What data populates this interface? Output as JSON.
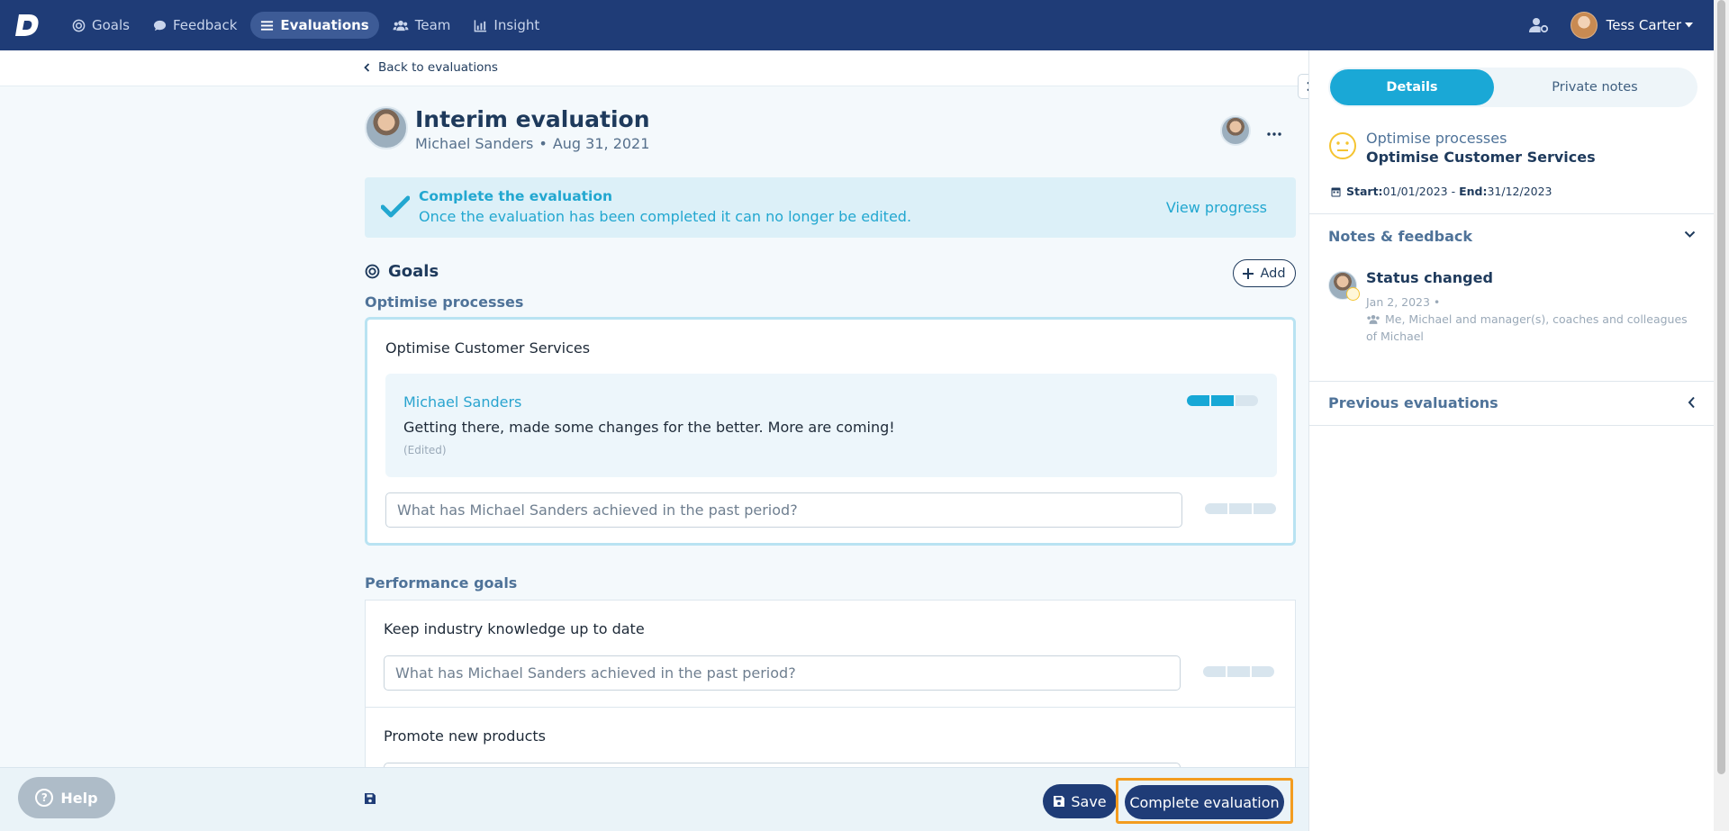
{
  "nav": {
    "items": [
      {
        "label": "Goals",
        "icon": "target-icon"
      },
      {
        "label": "Feedback",
        "icon": "chat-bubble-icon"
      },
      {
        "label": "Evaluations",
        "icon": "list-icon",
        "active": true
      },
      {
        "label": "Team",
        "icon": "users-icon"
      },
      {
        "label": "Insight",
        "icon": "bar-chart-icon"
      }
    ],
    "user_name": "Tess Carter"
  },
  "back_link": "Back to evaluations",
  "evaluation": {
    "title": "Interim evaluation",
    "person": "Michael Sanders",
    "separator": "•",
    "date": "Aug 31, 2021"
  },
  "banner": {
    "title": "Complete the evaluation",
    "text": "Once the evaluation has been completed it can no longer be edited.",
    "link": "View progress"
  },
  "goals_section": {
    "title": "Goals",
    "add_label": "Add",
    "groups": [
      {
        "label": "Optimise processes",
        "goals": [
          {
            "name": "Optimise Customer Services",
            "comment": {
              "author": "Michael Sanders",
              "text": "Getting there, made some changes for the better. More are coming!",
              "edited": "(Edited)",
              "rating": 2
            },
            "input_placeholder": "What has Michael Sanders achieved in the past period?"
          }
        ]
      },
      {
        "label": "Performance goals",
        "goals": [
          {
            "name": "Keep industry knowledge up to date",
            "input_placeholder": "What has Michael Sanders achieved in the past period?"
          },
          {
            "name": "Promote new products"
          }
        ]
      }
    ]
  },
  "bottom": {
    "help": "Help",
    "save": "Save",
    "complete": "Complete evaluation"
  },
  "side": {
    "tabs": [
      "Details",
      "Private notes"
    ],
    "goal": {
      "category": "Optimise processes",
      "name": "Optimise Customer Services",
      "start_label": "Start:",
      "start": "01/01/2023",
      "sep": " - ",
      "end_label": "End:",
      "end": "31/12/2023"
    },
    "notes_title": "Notes & feedback",
    "note": {
      "title": "Status changed",
      "date": "Jan 2, 2023 •",
      "visibility": "Me, Michael and manager(s), coaches and colleagues of Michael"
    },
    "previous_title": "Previous evaluations"
  },
  "colors": {
    "nav_bg": "#1f3c77",
    "accent": "#1aa8d6",
    "highlight_border": "#f39c1f"
  }
}
